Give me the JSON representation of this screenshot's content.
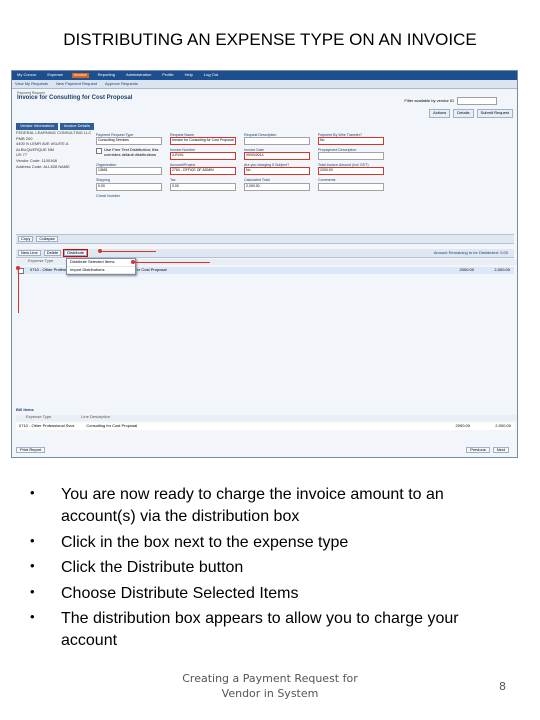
{
  "slide": {
    "title": "DISTRIBUTING AN EXPENSE TYPE ON AN INVOICE",
    "bullets": [
      "You are now ready to charge the invoice amount to an account(s) via the distribution box",
      "Click in the box next to the expense type",
      "Click the Distribute button",
      "Choose Distribute Selected Items",
      "The distribution box appears to allow you to charge your  account"
    ],
    "footer_line1": "Creating a Payment Request for",
    "footer_line2": "Vendor in System",
    "page_number": "8"
  },
  "app": {
    "nav": [
      "My Concur",
      "Expense",
      "Invoice",
      "Reporting",
      "Administration",
      "Profile",
      "Help",
      "Log Out"
    ],
    "subnav": [
      "View My Requests",
      "New Payment Request",
      "Approve Requests"
    ],
    "vendor_select_label": "Filter available by vendor ID",
    "breadcrumb": "Payment Request",
    "page_title": "Invoice for Consulting for Cost Proposal",
    "actions": [
      "Actions",
      "Details",
      "Submit Request"
    ],
    "tabs": [
      "Vendor Information",
      "Invoice Details"
    ],
    "vendor_info": [
      "FEDERAL LEARNING CONSULTING LLC",
      "PMB 200",
      "4400 N LEMR AVE #SUITE A",
      "ALBUQUERQUE NM",
      "US 77",
      "Vendor Code: 1100168",
      "Address Code: ALL828 NAME"
    ],
    "fields": [
      {
        "label": "Payment Request Type",
        "value": "Consulting Services"
      },
      {
        "label": "Request Name",
        "value": "Invoice for Consulting for Cost Proposal"
      },
      {
        "label": "Request Description",
        "value": ""
      },
      {
        "label": "Payment By Wire Transfer?",
        "value": "No"
      },
      {
        "label": "",
        "value": ""
      },
      {
        "label": "Invoice Number",
        "value": "3-RV01"
      },
      {
        "label": "Invoice Date",
        "value": "09/03/2014"
      },
      {
        "label": "Prepayment Description",
        "value": ""
      },
      {
        "label": "",
        "value": ""
      },
      {
        "label": "Organization",
        "value": "13651"
      },
      {
        "label": "Account/Project",
        "value": "2760 - OFFICE OF ADMIN"
      },
      {
        "label": "Are you charging 5 Subject?",
        "value": "No"
      },
      {
        "label": "Total Invoice Amount (Incl GST)",
        "value": "2000.00"
      },
      {
        "label": "",
        "value": ""
      },
      {
        "label": "Shipping",
        "value": "0.00"
      },
      {
        "label": "Tax",
        "value": "0.00"
      },
      {
        "label": "Calculated Total",
        "value": "2,000.00"
      },
      {
        "label": "Comments",
        "value": ""
      },
      {
        "label": "",
        "value": ""
      },
      {
        "label": "Check Number",
        "value": ""
      }
    ],
    "checkbox_text": "Use Free Text Distribution; this overrides default distributions",
    "toolbar1": [
      "Copy",
      "Collapse"
    ],
    "toolbar2": {
      "new": "New Line",
      "delete": "Delete",
      "distribute": "Distribute",
      "right": "Amount Remaining to be Distributed: 0.00"
    },
    "dropdown_items": [
      "Distribute Selected Items",
      "Import Distributions"
    ],
    "line_headers": [
      "Expense Type",
      "Line Description",
      "Amount",
      "Total"
    ],
    "line_row": {
      "type": "0710 - Other Professional",
      "desc": "Consulting for Cost Proposal",
      "amount": "2000.00",
      "total": "2,000.00"
    },
    "bill_title": "Bill Items",
    "bill_headers": [
      "Expense Type",
      "Line Description",
      "Amount",
      "Total"
    ],
    "bill_row": {
      "type": "0710 - Other Professional Svcs",
      "desc": "Consulting for Cost Proposal",
      "amount": "2000.00",
      "total": "2,000.00"
    },
    "bottom_left": "Print Report",
    "bottom_right": [
      "Previous",
      "Next"
    ]
  }
}
